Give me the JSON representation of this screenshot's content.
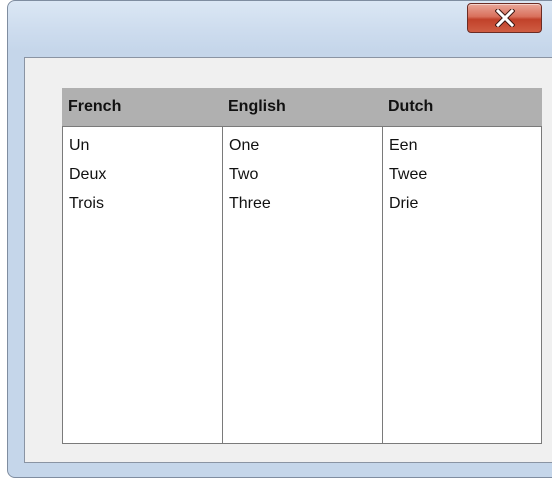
{
  "window": {
    "close_icon": "close-x-icon",
    "accent_close": "#c9452e",
    "titlebar_color": "#cddcee"
  },
  "table": {
    "columns": [
      {
        "header": "French",
        "cells": [
          "Un",
          "Deux",
          "Trois"
        ]
      },
      {
        "header": "English",
        "cells": [
          "One",
          "Two",
          "Three"
        ]
      },
      {
        "header": "Dutch",
        "cells": [
          "Een",
          "Twee",
          "Drie"
        ]
      }
    ],
    "header_bg": "#b0b0b0"
  }
}
